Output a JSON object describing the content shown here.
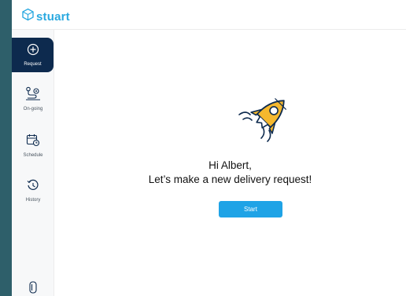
{
  "app": {
    "logo_text": "stuart"
  },
  "sidebar": {
    "items": [
      {
        "label": "Request",
        "icon": "plus-circle-icon",
        "active": true
      },
      {
        "label": "On-going",
        "icon": "route-pin-icon",
        "active": false
      },
      {
        "label": "Schedule",
        "icon": "calendar-clock-icon",
        "active": false
      },
      {
        "label": "History",
        "icon": "history-clock-icon",
        "active": false
      }
    ],
    "bottom_icon": "phone-icon"
  },
  "main": {
    "illustration": "rocket-icon",
    "greeting_line1": "Hi Albert,",
    "greeting_line2": "Let’s make a new delivery request!",
    "start_label": "Start"
  },
  "colors": {
    "brand": "#2aa9e0",
    "active_nav": "#0d2a4e",
    "button": "#1fa3e6",
    "rocket": "#f5b82e",
    "background": "#2e5f6a"
  }
}
